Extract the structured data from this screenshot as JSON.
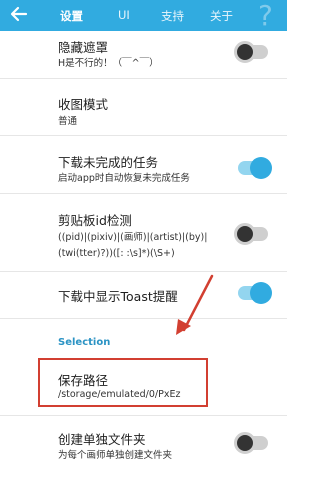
{
  "toolbar": {
    "tabs": [
      "设置",
      "UI",
      "支持",
      "关于"
    ],
    "active_tab": "设置",
    "help": "?"
  },
  "settings": {
    "hide_mask": {
      "title": "隐藏遮罩",
      "subtitle": "H是不行的！（￣^￣）",
      "enabled": false
    },
    "collection_mode": {
      "title": "收图模式",
      "subtitle": "普通"
    },
    "resume_downloads": {
      "title": "下载未完成的任务",
      "subtitle": "启动app时自动恢复未完成任务",
      "enabled": true
    },
    "clipboard_id": {
      "title": "剪贴板id检测",
      "subtitle_lines": [
        "((pid)|(pixiv)|(画师)|(artist)|(by)|",
        "(twi(tter)?))([: :\\s]*)(\\S+)"
      ],
      "enabled": false
    },
    "download_toast": {
      "title": "下载中显示Toast提醒",
      "enabled": true
    }
  },
  "section_header": "Selection",
  "save_path": {
    "title": "保存路径",
    "value": "/storage/emulated/0/PxEz"
  },
  "per_artist_folder": {
    "title": "创建单独文件夹",
    "subtitle": "为每个画师单独创建文件夹",
    "enabled": false
  },
  "colors": {
    "accent": "#31abe0",
    "annotation": "#d23f31"
  }
}
